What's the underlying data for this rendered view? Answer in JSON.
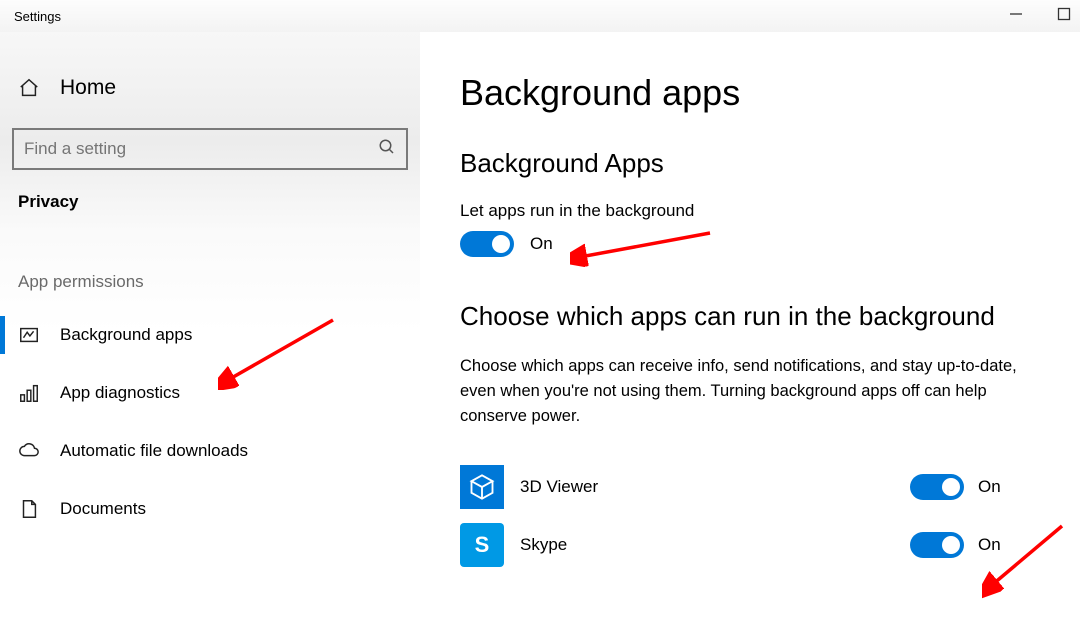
{
  "window": {
    "title": "Settings"
  },
  "sidebar": {
    "home_label": "Home",
    "search_placeholder": "Find a setting",
    "category_label": "Privacy",
    "section_label": "App permissions",
    "items": [
      {
        "label": "Background apps",
        "icon": "background-apps-icon",
        "active": true
      },
      {
        "label": "App diagnostics",
        "icon": "diagnostics-icon",
        "active": false
      },
      {
        "label": "Automatic file downloads",
        "icon": "cloud-icon",
        "active": false
      },
      {
        "label": "Documents",
        "icon": "document-icon",
        "active": false
      }
    ]
  },
  "main": {
    "page_title": "Background apps",
    "group1_title": "Background Apps",
    "setting1_label": "Let apps run in the background",
    "setting1_state": "On",
    "group2_title": "Choose which apps can run in the background",
    "group2_desc": "Choose which apps can receive info, send notifications, and stay up-to-date, even when you're not using them. Turning background apps off can help conserve power.",
    "apps": [
      {
        "name": "3D Viewer",
        "state": "On"
      },
      {
        "name": "Skype",
        "state": "On"
      }
    ]
  }
}
